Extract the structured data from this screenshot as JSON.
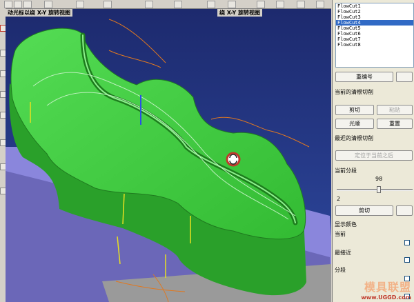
{
  "viewport": {
    "title_left": "动光标以绕 X-Y 旋转视图",
    "title_right": "绕 X-Y 旋转视图"
  },
  "panel": {
    "flowcuts": [
      "FlowCut1",
      "FlowCut2",
      "FlowCut3",
      "FlowCut4",
      "FlowCut5",
      "FlowCut6",
      "FlowCut7",
      "FlowCut8"
    ],
    "selected_index": 3,
    "renumber_label": "重编号",
    "current_section": "当前的清根切削",
    "cut_label": "剪切",
    "paste_label": "粘贴",
    "smooth_label": "光顺",
    "reset_label": "重置",
    "recent_section": "最近的清根切削",
    "place_label": "定位于当前之后",
    "segment_section": "当前分段",
    "slider_value": "98",
    "slider_min": "2",
    "slider_fraction": 0.56,
    "cut2_label": "剪切",
    "display_color_section": "显示颜色",
    "color_current": "当前",
    "color_recent": "最接近",
    "color_segment": "分段"
  },
  "brand": {
    "name": "模具联盟",
    "url": "www.UGGD.com"
  },
  "colors": {
    "part_green": "#3cc83c",
    "background_blue": "#1f2f78",
    "fixture_lavender": "#8a86dc",
    "selection": "#316ac5"
  }
}
